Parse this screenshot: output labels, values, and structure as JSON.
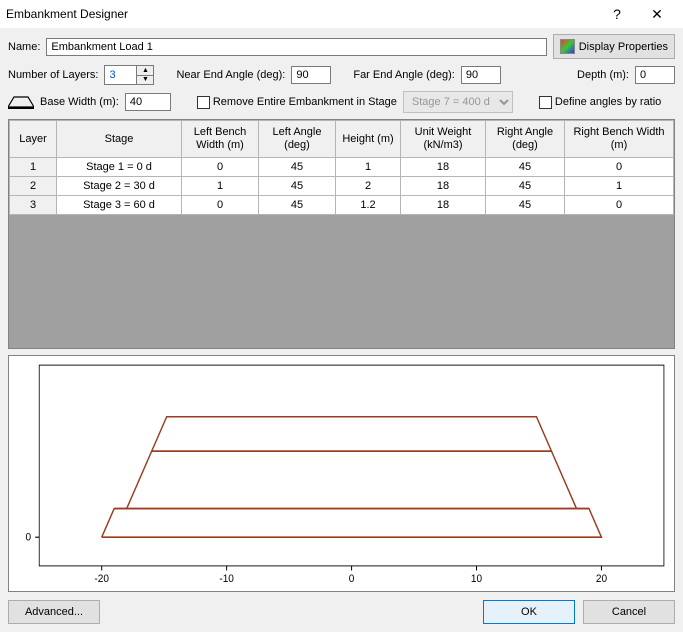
{
  "window": {
    "title": "Embankment Designer"
  },
  "labels": {
    "name": "Name:",
    "display_properties": "Display Properties",
    "num_layers": "Number of Layers:",
    "near_angle": "Near End Angle (deg):",
    "far_angle": "Far End Angle (deg):",
    "depth": "Depth (m):",
    "base_width": "Base Width (m):",
    "remove_in_stage": "Remove Entire Embankment in Stage",
    "define_by_ratio": "Define angles by ratio"
  },
  "fields": {
    "name": "Embankment Load 1",
    "num_layers": "3",
    "near_angle": "90",
    "far_angle": "90",
    "depth": "0",
    "base_width": "40",
    "remove_stage_option": "Stage 7 = 400 d"
  },
  "table": {
    "headers": [
      "Layer",
      "Stage",
      "Left Bench Width (m)",
      "Left Angle (deg)",
      "Height (m)",
      "Unit Weight (kN/m3)",
      "Right Angle (deg)",
      "Right Bench Width (m)"
    ],
    "rows": [
      {
        "layer": "1",
        "stage": "Stage 1 = 0 d",
        "lbw": "0",
        "la": "45",
        "h": "1",
        "uw": "18",
        "ra": "45",
        "rbw": "0"
      },
      {
        "layer": "2",
        "stage": "Stage 2 = 30 d",
        "lbw": "1",
        "la": "45",
        "h": "2",
        "uw": "18",
        "ra": "45",
        "rbw": "1"
      },
      {
        "layer": "3",
        "stage": "Stage 3 = 60 d",
        "lbw": "0",
        "la": "45",
        "h": "1.2",
        "uw": "18",
        "ra": "45",
        "rbw": "0"
      }
    ]
  },
  "chart_data": {
    "type": "line",
    "title": "",
    "xlabel": "",
    "ylabel": "",
    "xlim": [
      -25,
      25
    ],
    "ylim": [
      -1,
      6
    ],
    "x_ticks": [
      -20,
      -10,
      0,
      10,
      20
    ],
    "y_ticks": [
      0
    ],
    "series": [
      {
        "name": "layer1",
        "color": "#9b3b1f",
        "x": [
          -20,
          -19,
          19,
          20,
          -20
        ],
        "y": [
          0,
          1,
          1,
          0,
          0
        ]
      },
      {
        "name": "layer2",
        "color": "#9b3b1f",
        "x": [
          -19,
          -18,
          -16,
          16,
          18,
          19,
          -19
        ],
        "y": [
          1,
          1,
          3,
          3,
          1,
          1,
          1
        ]
      },
      {
        "name": "layer3",
        "color": "#9b3b1f",
        "x": [
          -16,
          -14.8,
          14.8,
          16,
          -16
        ],
        "y": [
          3,
          4.2,
          4.2,
          3,
          3
        ]
      }
    ]
  },
  "buttons": {
    "advanced": "Advanced...",
    "ok": "OK",
    "cancel": "Cancel"
  }
}
